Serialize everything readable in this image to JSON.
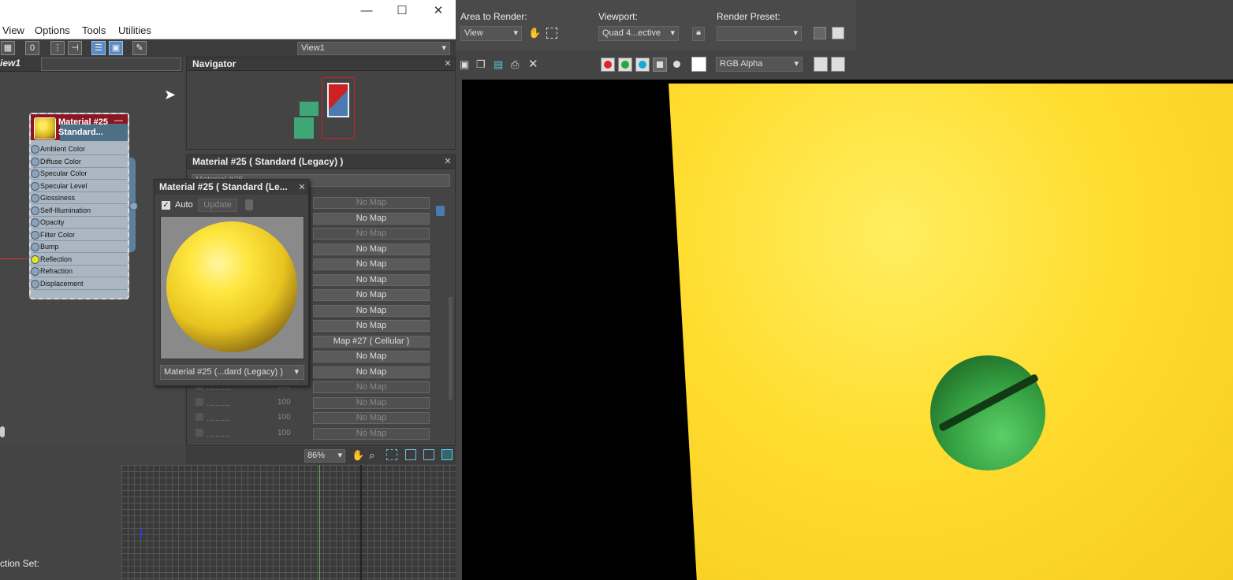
{
  "left_window": {
    "menu": [
      "View",
      "Options",
      "Tools",
      "Utilities"
    ],
    "view_select": "View1",
    "view_tab": "iew1",
    "node": {
      "title_line1": "Material #25",
      "title_line2": "Standard...",
      "slots": [
        "Ambient Color",
        "Diffuse Color",
        "Specular Color",
        "Specular Level",
        "Glossiness",
        "Self-Illumination",
        "Opacity",
        "Filter Color",
        "Bump",
        "Reflection",
        "Refraction",
        "Displacement"
      ]
    },
    "navigator_title": "Navigator",
    "param_panel_title": "Material #25  ( Standard (Legacy) )",
    "param_name_field": "Material #25",
    "maps": [
      "No Map",
      "No Map",
      "No Map",
      "No Map",
      "No Map",
      "No Map",
      "No Map",
      "No Map",
      "No Map",
      "Map #27  ( Cellular )",
      "No Map",
      "No Map",
      "No Map",
      "No Map",
      "No Map",
      "No Map",
      "No Map"
    ],
    "amount_rows": [
      {
        "dots": "...........",
        "value": "100"
      },
      {
        "dots": "...........",
        "value": "100"
      },
      {
        "dots": "...........",
        "value": "100"
      },
      {
        "dots": "...........",
        "value": "100"
      }
    ],
    "preview": {
      "title": "Material #25  ( Standard (Le...",
      "auto_label": "Auto",
      "update_label": "Update",
      "select_value": "Material #25  (...dard (Legacy) )"
    },
    "zoom": "86%",
    "selection_set_label": "ction Set:"
  },
  "render_window": {
    "area_label": "Area to Render:",
    "area_value": "View",
    "viewport_label": "Viewport:",
    "viewport_value": "Quad 4...ective",
    "preset_label": "Render Preset:",
    "channel_value": "RGB Alpha"
  },
  "colors": {
    "accent_blue": "#5a8bc4",
    "material_red": "#8b1520",
    "bg_yellow": "#ffdd30",
    "ball_green": "#36a243"
  }
}
